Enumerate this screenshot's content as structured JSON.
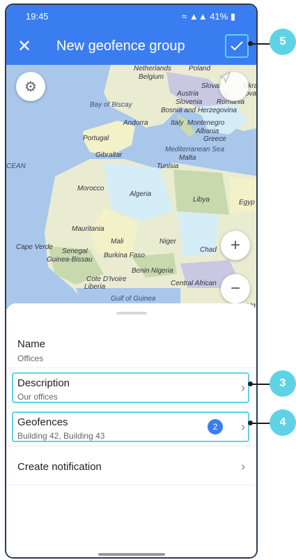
{
  "status_bar": {
    "time": "19:45",
    "battery": "41%"
  },
  "app_bar": {
    "title": "New geofence group"
  },
  "map": {
    "labels": {
      "netherlands": "Netherlands",
      "belgium": "Belgium",
      "poland": "Poland",
      "slovak": "Slovak",
      "ukra": "Ukra",
      "austria": "Austria",
      "slovenia": "Slovenia",
      "romania": "Romania",
      "bosnia": "Bosnia and Herzegovina",
      "italy": "Italy",
      "montenegro": "Montenegro",
      "albania": "Albania",
      "greece": "Greece",
      "bay_of_biscay": "Bay of Biscay",
      "andorra": "Andorra",
      "portugal": "Portugal",
      "gibraltar": "Gibraltar",
      "mediterranean": "Mediterranean Sea",
      "malta": "Malta",
      "tunisia": "Tunisia",
      "ocean": "CEAN",
      "morocco": "Morocco",
      "algeria": "Algeria",
      "libya": "Libya",
      "egypt": "Egyp",
      "mauritania": "Mauritania",
      "mali": "Mali",
      "niger": "Niger",
      "chad": "Chad",
      "cape_verde": "Cape Verde",
      "senegal": "Senegal",
      "guinea_bissau": "Guinea-Bissau",
      "burkina_faso": "Burkina Faso",
      "benin": "Benin",
      "nigeria": "Nigeria",
      "cote_divoire": "Cote D'Ivoire",
      "liberia": "Liberia",
      "central_african": "Central African",
      "gulf_of_guinea": "Gulf of Guinea",
      "ug": "Ug",
      "ova": "ova"
    },
    "colors": {
      "sea": "#a9c7ea",
      "land_a": "#e9ecd0",
      "land_b": "#d4edf6",
      "land_c": "#f3f1c8",
      "land_d": "#c8d9ad",
      "land_e": "#c9c8e2"
    }
  },
  "form": {
    "name_label": "Name",
    "name_value": "Offices",
    "description_label": "Description",
    "description_value": "Our offices",
    "geofences_label": "Geofences",
    "geofences_value": "Building 42, Building 43",
    "geofences_count": "2",
    "create_notification_label": "Create notification"
  },
  "callouts": {
    "confirm": "5",
    "description": "3",
    "geofences": "4"
  },
  "colors": {
    "primary": "#3a7df0",
    "highlight": "#5fd3e6"
  }
}
